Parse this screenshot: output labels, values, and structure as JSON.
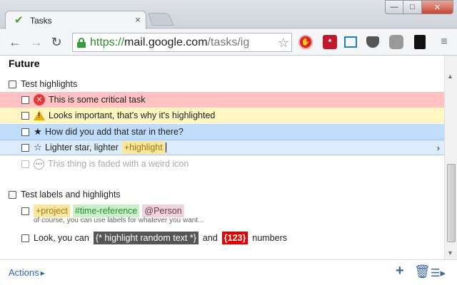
{
  "browser": {
    "tab_title": "Tasks",
    "tab_close": "×",
    "url_scheme": "https://",
    "url_host": "mail.google.com",
    "url_path": "/tasks/ig",
    "window_minimize": "—",
    "window_maximize": "□",
    "window_close": "✕"
  },
  "tasks": {
    "section_title": "Future",
    "groups": [
      {
        "title": "Test highlights",
        "items": [
          {
            "text": "This is some critical task",
            "highlight": "red",
            "icon": "critical-icon"
          },
          {
            "text": "Looks important, that's why it's highlighted",
            "highlight": "yellow",
            "icon": "warning-icon"
          },
          {
            "star": "★",
            "text": "How did you add that star in there?",
            "highlight": "blue",
            "icon": "filled-star-icon"
          },
          {
            "star": "☆",
            "text": "Lighter star, lighter",
            "tag": "+highlight",
            "highlight": "lightblue",
            "icon": "outline-star-icon"
          },
          {
            "text": "This thing is faded with a weird icon",
            "highlight": "none",
            "icon": "faded-circle-icon"
          }
        ]
      },
      {
        "title": "Test labels and highlights",
        "items": [
          {
            "tags": [
              "+project",
              "#time-reference",
              "@Person"
            ],
            "note": "of course, you can use labels for whatever you want..."
          },
          {
            "prefix": "Look, you can",
            "random_tag": "{* highlight random text *}",
            "middle": "and",
            "number_tag": "{123}",
            "suffix": "numbers"
          }
        ]
      }
    ]
  },
  "footer": {
    "actions_label": "Actions"
  },
  "colors": {
    "critical": "#ffc1c1",
    "important": "#fff6c2",
    "star": "#bfdcfb",
    "light_star": "#dcecfd",
    "link": "#2d65b5"
  }
}
